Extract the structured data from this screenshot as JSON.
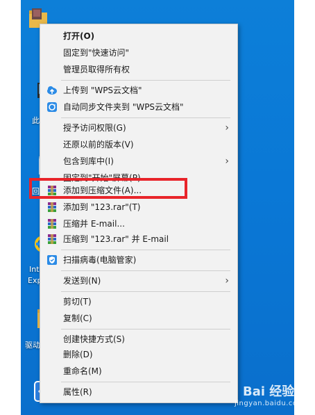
{
  "desktop": {
    "icons": [
      {
        "label": "",
        "icon": "folder-icon"
      },
      {
        "label": "此",
        "icon": "computer-icon"
      },
      {
        "label": "回",
        "icon": "recycle-bin-icon"
      },
      {
        "label": "Int",
        "icon": "internet-explorer-icon"
      },
      {
        "label": "Exp",
        "icon": "internet-explorer-icon"
      },
      {
        "label": "驱动",
        "icon": "folder-icon"
      }
    ]
  },
  "menu": {
    "items": [
      {
        "label": "打开(O)",
        "bold": true
      },
      {
        "label": "固定到\"快速访问\""
      },
      {
        "label": "管理员取得所有权"
      },
      {
        "label": "上传到 \"WPS云文档\"",
        "icon": "cloud-upload-icon"
      },
      {
        "label": "自动同步文件夹到 \"WPS云文档\"",
        "icon": "sync-folder-icon"
      },
      {
        "label": "授予访问权限(G)",
        "submenu": true
      },
      {
        "label": "还原以前的版本(V)"
      },
      {
        "label": "包含到库中(I)",
        "submenu": true
      },
      {
        "label": "固定到\"开始\"屏幕(P)"
      },
      {
        "label": "添加到压缩文件(A)...",
        "icon": "winrar-icon"
      },
      {
        "label": "添加到 \"123.rar\"(T)",
        "icon": "winrar-icon"
      },
      {
        "label": "压缩并 E-mail...",
        "icon": "winrar-icon"
      },
      {
        "label": "压缩到 \"123.rar\" 并 E-mail",
        "icon": "winrar-icon"
      },
      {
        "label": "扫描病毒(电脑管家)",
        "icon": "shield-icon"
      },
      {
        "label": "发送到(N)",
        "submenu": true
      },
      {
        "label": "剪切(T)"
      },
      {
        "label": "复制(C)"
      },
      {
        "label": "创建快捷方式(S)"
      },
      {
        "label": "删除(D)"
      },
      {
        "label": "重命名(M)"
      },
      {
        "label": "属性(R)"
      }
    ],
    "submenu_glyph": "›"
  },
  "watermark": {
    "brand": "Bai 经验",
    "url": "jingyan.baidu.com"
  }
}
